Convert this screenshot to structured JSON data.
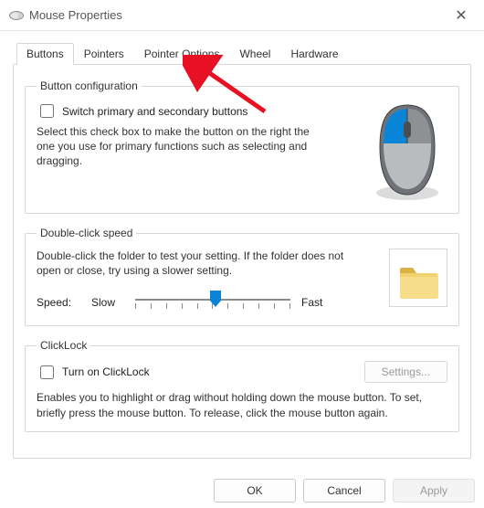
{
  "window": {
    "title": "Mouse Properties"
  },
  "tabs": [
    "Buttons",
    "Pointers",
    "Pointer Options",
    "Wheel",
    "Hardware"
  ],
  "active_tab_index": 0,
  "button_config": {
    "legend": "Button configuration",
    "checkbox_label": "Switch primary and secondary buttons",
    "checked": false,
    "description": "Select this check box to make the button on the right the one you use for primary functions such as selecting and dragging."
  },
  "double_click": {
    "legend": "Double-click speed",
    "description": "Double-click the folder to test your setting. If the folder does not open or close, try using a slower setting.",
    "speed_label": "Speed:",
    "slow_label": "Slow",
    "fast_label": "Fast",
    "slider_value_percent": 52
  },
  "clicklock": {
    "legend": "ClickLock",
    "checkbox_label": "Turn on ClickLock",
    "checked": false,
    "settings_button": "Settings...",
    "settings_enabled": false,
    "description": "Enables you to highlight or drag without holding down the mouse button. To set, briefly press the mouse button. To release, click the mouse button again."
  },
  "footer": {
    "ok": "OK",
    "cancel": "Cancel",
    "apply": "Apply"
  },
  "annotation": {
    "arrow_target_tab": "Pointer Options"
  }
}
